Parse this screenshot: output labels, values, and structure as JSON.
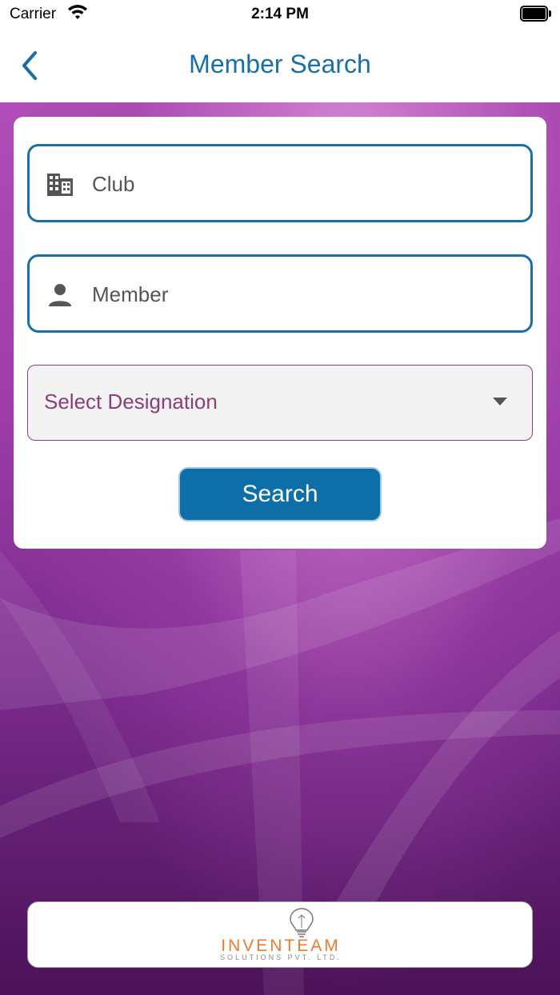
{
  "status_bar": {
    "carrier": "Carrier",
    "time": "2:14 PM"
  },
  "nav": {
    "title": "Member Search",
    "back_icon": "chevron-left-icon"
  },
  "form": {
    "club_placeholder": "Club",
    "club_icon": "building-icon",
    "member_placeholder": "Member",
    "member_icon": "person-icon",
    "designation_placeholder": "Select Designation",
    "designation_icon": "caret-down-icon",
    "search_label": "Search"
  },
  "footer": {
    "brand": "INVENTEAM",
    "tagline": "SOLUTIONS PVT. LTD.",
    "logo_icon": "lightbulb-icon"
  },
  "colors": {
    "accent": "#1a6fa6",
    "button": "#0e6fa8",
    "dropdown_text": "#8a3e7a",
    "brand_orange": "#ee7a2c"
  }
}
